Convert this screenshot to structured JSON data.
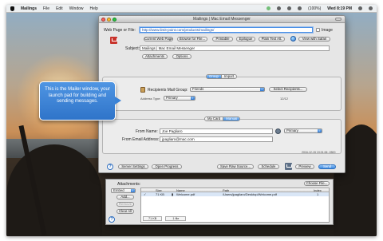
{
  "menubar": {
    "app": "Mailings",
    "menus": [
      "File",
      "Edit",
      "Window",
      "Help"
    ],
    "battery": "(100%)",
    "clock": "Wed 8:19 PM"
  },
  "window": {
    "title": "Mailings | Mac Email Messenger",
    "webpage_label": "Web Page or File:",
    "url": "http://www.limit-point.com/products/mailings/",
    "image_check": "Image",
    "buttons": [
      "Current Web Page",
      "Browse for File...",
      "Printable",
      "Epilogue",
      "Plain Text Alt."
    ],
    "view_safari": "View with Safari",
    "subject_label": "Subject:",
    "subject": "Mailings | Mac Email Messenger",
    "attachments_btn": "Attachments",
    "options_btn": "Options",
    "group_tabs": [
      "Group",
      "Import"
    ],
    "recipients_group_label": "Recipients Mail Group:",
    "recipients_group": "Friends",
    "select_recipients": "Select Recipients...",
    "address_type_label": "Address Type:",
    "address_type": "Primary",
    "count": "12/12",
    "card_tabs": [
      "My Card",
      "Manual"
    ],
    "from_name_label": "From Name:",
    "from_name": "Joe Pagliaro",
    "from_email_label": "From Email Address:",
    "from_email": "jpagliaro@mac.com",
    "sender_type": "Primary",
    "timestamp": "2016-12-15 19:01:06 -0500",
    "bottom": {
      "server_settings": "Server Settings",
      "open_progress": "Open Progress",
      "save_raw": "Save Raw Source...",
      "schedule": "Schedule",
      "preview": "Preview",
      "send": "Send"
    }
  },
  "callout": "This is the Mailer window, your launch pad for building and sending messages.",
  "attachments_panel": {
    "label": "Attachments:",
    "choose_file": "Choose File...",
    "embed": "Embed",
    "add": "Add...",
    "remove": "Remove",
    "clear_all": "Clear All",
    "columns": [
      "",
      "Size",
      "Name",
      "Path",
      "Index"
    ],
    "rows": [
      {
        "check": "✓",
        "size": "71 KB",
        "name": "Welcome.pdf",
        "path": "/Users/jpagliaro/Desktop/Welcome.pdf",
        "index": "1"
      }
    ],
    "totals": [
      "71 KB",
      "1 file"
    ]
  }
}
